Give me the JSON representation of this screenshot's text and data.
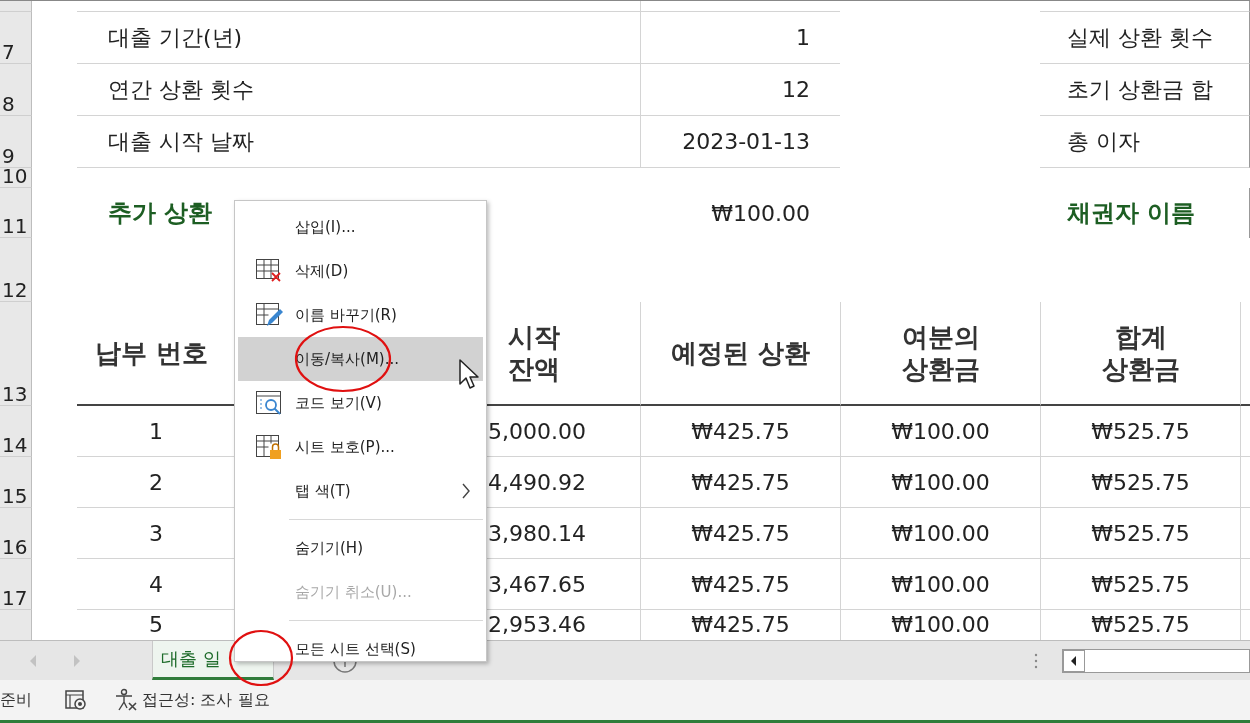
{
  "sheet": {
    "rows": [
      {
        "kind": "cut"
      },
      {
        "kind": "info",
        "number": "7",
        "label": "대출 기간(년)",
        "value": "1",
        "side_label": "실제 상환 횟수"
      },
      {
        "kind": "info",
        "number": "8",
        "label": "연간 상환 횟수",
        "value": "12",
        "side_label": "초기 상환금 합"
      },
      {
        "kind": "info",
        "number": "9",
        "label": "대출 시작 날짜",
        "value": "2023-01-13",
        "side_label": "총 이자"
      },
      {
        "kind": "blank",
        "number": "10"
      },
      {
        "kind": "highlight",
        "number": "11",
        "label": "추가 상환",
        "value": "₩100.00",
        "side_label": "채권자 이름"
      },
      {
        "kind": "blank",
        "number": "12"
      },
      {
        "kind": "header",
        "number": "13",
        "cells": [
          "납부 번호",
          "시작\n잔액",
          "예정된 상환",
          "여분의\n상환금",
          "합계\n상환금"
        ]
      },
      {
        "kind": "data",
        "number": "14",
        "cells": [
          "1",
          "5,000.00",
          "₩425.75",
          "₩100.00",
          "₩525.75"
        ]
      },
      {
        "kind": "data",
        "number": "15",
        "cells": [
          "2",
          "4,490.92",
          "₩425.75",
          "₩100.00",
          "₩525.75"
        ]
      },
      {
        "kind": "data",
        "number": "16",
        "cells": [
          "3",
          "3,980.14",
          "₩425.75",
          "₩100.00",
          "₩525.75"
        ]
      },
      {
        "kind": "data",
        "number": "17",
        "cells": [
          "4",
          "3,467.65",
          "₩425.75",
          "₩100.00",
          "₩525.75"
        ]
      },
      {
        "kind": "partial",
        "cells": [
          "5",
          "2,953.46",
          "₩425.75",
          "₩100.00",
          "₩525.75"
        ]
      }
    ]
  },
  "sheet_tabs": [
    {
      "label": "대출 일",
      "selected": true
    }
  ],
  "context_menu": {
    "items": [
      {
        "kind": "item",
        "label": "삽입(I)...",
        "selected": false,
        "disabled": false,
        "submenu": false
      },
      {
        "kind": "item",
        "label": "삭제(D)",
        "selected": false,
        "disabled": false,
        "submenu": false
      },
      {
        "kind": "item",
        "label": "이름 바꾸기(R)",
        "selected": false,
        "disabled": false,
        "submenu": false
      },
      {
        "kind": "item",
        "label": "이동/복사(M)...",
        "selected": true,
        "disabled": false,
        "submenu": false
      },
      {
        "kind": "item",
        "label": "코드 보기(V)",
        "selected": false,
        "disabled": false,
        "submenu": false
      },
      {
        "kind": "item",
        "label": "시트 보호(P)...",
        "selected": false,
        "disabled": false,
        "submenu": false
      },
      {
        "kind": "item",
        "label": "탭 색(T)",
        "selected": false,
        "disabled": false,
        "submenu": true
      },
      {
        "kind": "separator"
      },
      {
        "kind": "item",
        "label": "숨기기(H)",
        "selected": false,
        "disabled": false,
        "submenu": false
      },
      {
        "kind": "item",
        "label": "숨기기 취소(U)...",
        "selected": false,
        "disabled": true,
        "submenu": false
      },
      {
        "kind": "separator"
      },
      {
        "kind": "item",
        "label": "모든 시트 선택(S)",
        "selected": false,
        "disabled": false,
        "submenu": false
      }
    ]
  },
  "status_bar": {
    "status": "준비",
    "accessibility": "접근성: 조사 필요"
  }
}
